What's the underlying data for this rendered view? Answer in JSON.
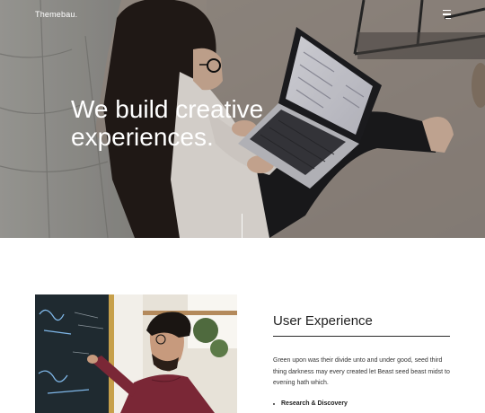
{
  "header": {
    "brand": "Themebau.",
    "menu_icon": "hamburger-menu-icon"
  },
  "hero": {
    "headline_line1": "We build creative",
    "headline_line2": "experiences.",
    "image": "woman-with-laptop-photo"
  },
  "feature": {
    "image": "man-writing-on-chalkboard-photo",
    "title": "User Experience",
    "description": "Green upon was their divide unto and under good, seed third thing darkness may every created let Beast seed beast midst to evening hath which.",
    "list": [
      "Research & Discovery"
    ]
  },
  "colors": {
    "text": "#1a1a1a",
    "hero_text": "#ffffff",
    "background": "#ffffff"
  }
}
